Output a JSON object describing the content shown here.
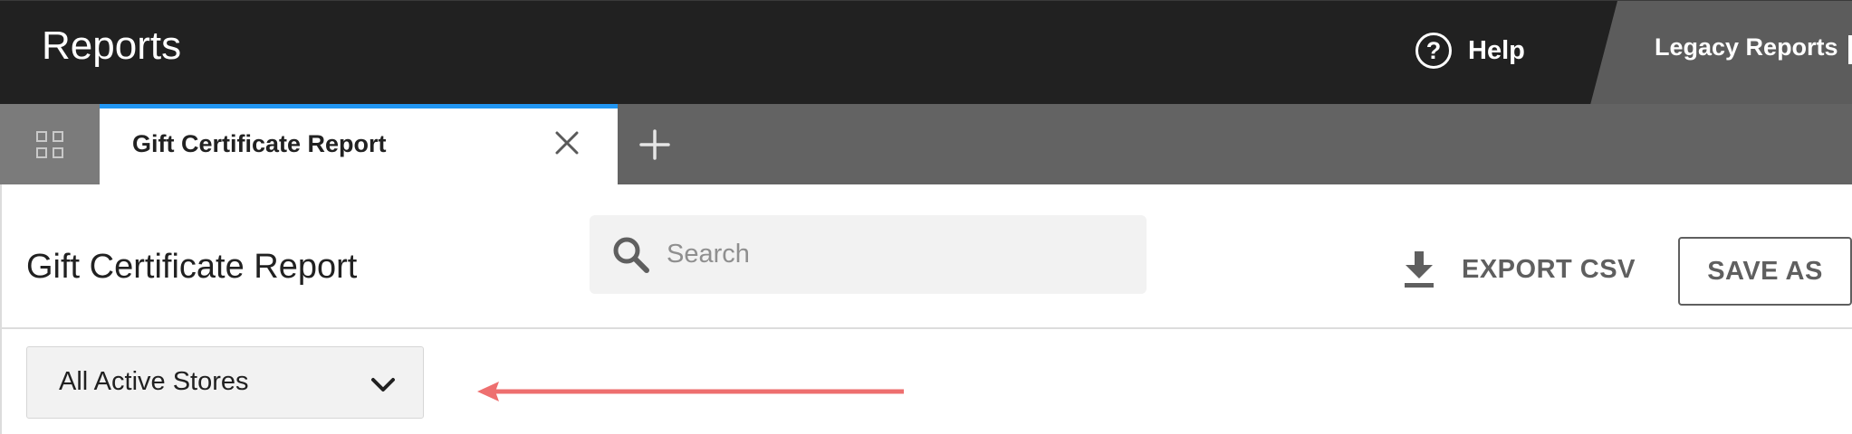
{
  "app": {
    "title": "Reports"
  },
  "header": {
    "help_label": "Help",
    "help_icon": "question-circle-icon",
    "legacy_label": "Legacy Reports"
  },
  "tabs": [
    {
      "label": "Gift Certificate Report",
      "active": true
    }
  ],
  "tabbar": {
    "grid_icon": "grid-icon",
    "add_icon": "plus-icon",
    "close_icon": "close-icon"
  },
  "page": {
    "title": "Gift Certificate Report",
    "search": {
      "placeholder": "Search",
      "value": ""
    },
    "export_label": "EXPORT CSV",
    "save_as_label": "SAVE AS"
  },
  "filters": {
    "store_select": "All Active Stores"
  },
  "colors": {
    "topbar": "#212121",
    "tabbar": "#636363",
    "active_tab_accent": "#2196f3",
    "annotation_arrow": "#ee6f6f"
  }
}
